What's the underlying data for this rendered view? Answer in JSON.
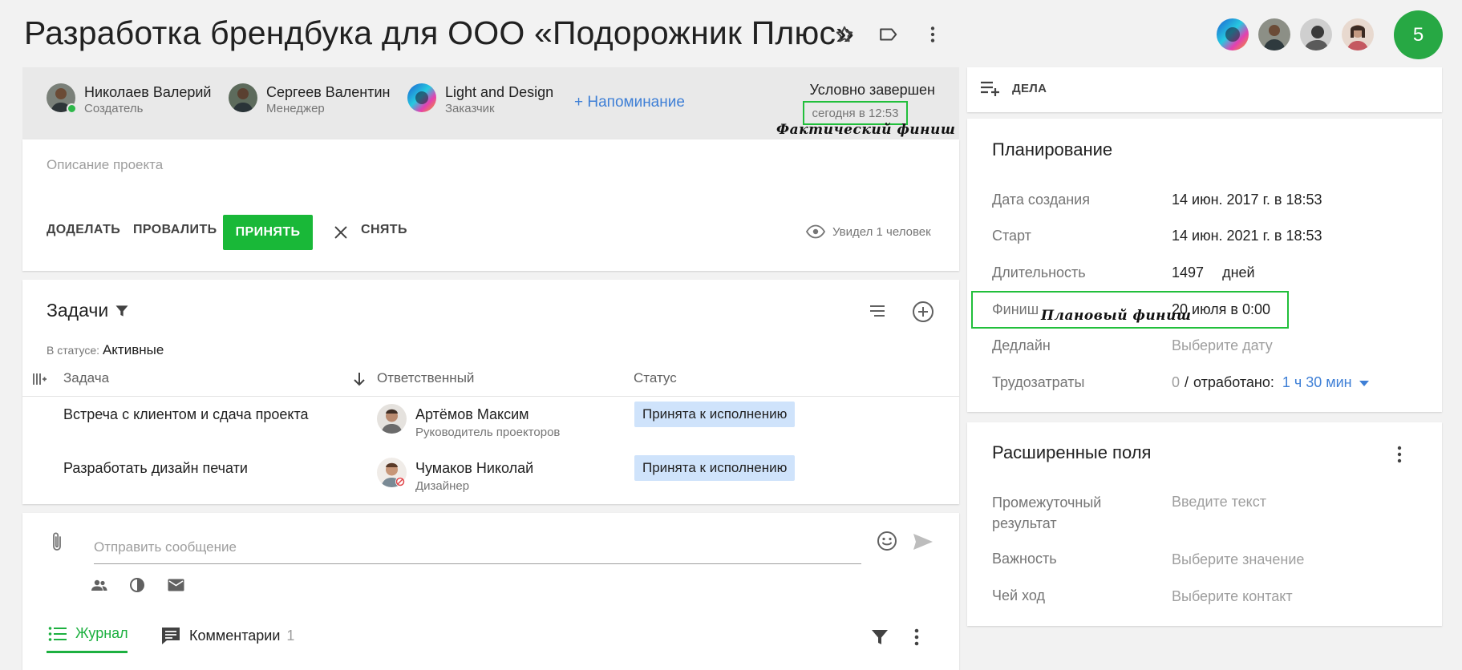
{
  "header": {
    "title": "Разработка брендбука для ООО «Подорожник Плюс»",
    "icons": [
      "star-icon",
      "label-icon",
      "more-vert-icon"
    ],
    "counter": "5"
  },
  "project": {
    "participants": [
      {
        "name": "Николаев Валерий",
        "role": "Создатель"
      },
      {
        "name": "Сергеев Валентин",
        "role": "Менеджер"
      },
      {
        "name": "Light and Design",
        "role": "Заказчик"
      }
    ],
    "reminder_label": "+ Напоминание",
    "status": "Условно завершен",
    "status_time": "сегодня в 12:53",
    "fact_finish_note": "Фактический финиш",
    "description_placeholder": "Описание проекта",
    "buttons": {
      "redo": "ДОДЕЛАТЬ",
      "fail": "ПРОВАЛИТЬ",
      "accept": "ПРИНЯТЬ",
      "remove": "СНЯТЬ"
    },
    "seen": "Увидел 1 человек"
  },
  "tasks": {
    "title": "Задачи",
    "filter_label": "В статусе:",
    "filter_value": "Активные",
    "columns": {
      "task": "Задача",
      "responsible": "Ответственный",
      "status": "Статус"
    },
    "rows": [
      {
        "task": "Встреча с клиентом и сдача проекта",
        "name": "Артёмов Максим",
        "role": "Руководитель проекторов",
        "status": "Принята к исполнению"
      },
      {
        "task": "Разработать дизайн печати",
        "name": "Чумаков Николай",
        "role": "Дизайнер",
        "status": "Принята к исполнению"
      }
    ]
  },
  "message": {
    "placeholder": "Отправить сообщение",
    "tabs": {
      "journal": "Журнал",
      "comments": "Комментарии",
      "comments_count": "1"
    }
  },
  "deals": {
    "label": "ДЕЛА"
  },
  "planning": {
    "title": "Планирование",
    "rows": {
      "created_label": "Дата создания",
      "created_value": "14 июн. 2017 г. в 18:53",
      "start_label": "Старт",
      "start_value": "14 июн. 2021 г. в 18:53",
      "duration_label": "Длительность",
      "duration_value": "1497",
      "duration_unit": "дней",
      "finish_label": "Финиш",
      "finish_value": "20 июля в 0:00",
      "deadline_label": "Дедлайн",
      "deadline_value": "Выберите дату",
      "effort_label": "Трудозатраты",
      "effort_planned": "0",
      "effort_sep": "/",
      "effort_done_label": "отработано:",
      "effort_done": "1 ч 30 мин"
    },
    "plan_finish_note": "Плановый финиш"
  },
  "extended": {
    "title": "Расширенные поля",
    "fields": [
      {
        "label": "Промежуточный результат",
        "value": "Введите текст"
      },
      {
        "label": "Важность",
        "value": "Выберите значение"
      },
      {
        "label": "Чей ход",
        "value": "Выберите контакт"
      }
    ]
  },
  "colors": {
    "accent_green": "#19b838",
    "link_blue": "#3e7fd6",
    "badge_blue": "#cfe3fb",
    "highlight_green": "#21bf3b"
  }
}
